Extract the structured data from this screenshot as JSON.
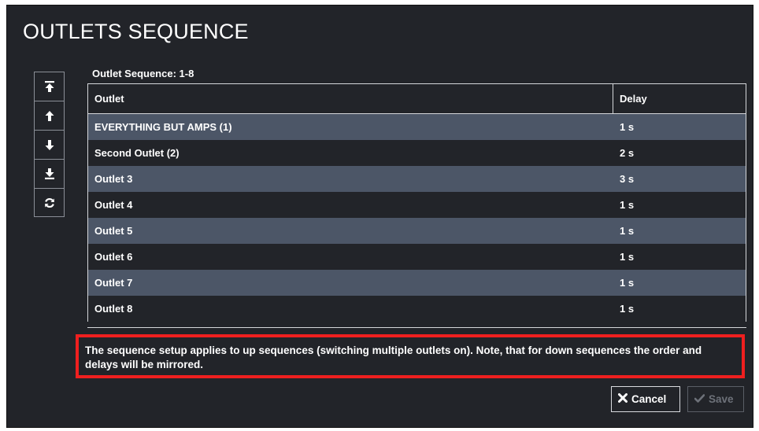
{
  "dialog": {
    "title": "OUTLETS SEQUENCE"
  },
  "toolbar": {
    "buttons": [
      {
        "icon": "move-to-top-icon"
      },
      {
        "icon": "move-up-icon"
      },
      {
        "icon": "move-down-icon"
      },
      {
        "icon": "move-to-bottom-icon"
      },
      {
        "icon": "refresh-icon"
      }
    ]
  },
  "sequence": {
    "label": "Outlet Sequence:  1-8"
  },
  "table": {
    "headers": [
      "Outlet",
      "Delay"
    ],
    "rows": [
      {
        "outlet": "EVERYTHING BUT AMPS (1)",
        "delay": "1 s"
      },
      {
        "outlet": "Second Outlet (2)",
        "delay": "2 s"
      },
      {
        "outlet": "Outlet 3",
        "delay": "3 s"
      },
      {
        "outlet": "Outlet 4",
        "delay": "1 s"
      },
      {
        "outlet": "Outlet 5",
        "delay": "1 s"
      },
      {
        "outlet": "Outlet 6",
        "delay": "1 s"
      },
      {
        "outlet": "Outlet 7",
        "delay": "1 s"
      },
      {
        "outlet": "Outlet 8",
        "delay": "1 s"
      }
    ]
  },
  "note": {
    "text": "The sequence setup applies to up sequences (switching multiple outlets on). Note, that for down sequences the order and delays will be mirrored."
  },
  "actions": {
    "cancel_label": "Cancel",
    "save_label": "Save"
  },
  "colors": {
    "background": "#222429",
    "row_highlight": "#4c5667",
    "note_border": "#ef1f1f"
  }
}
